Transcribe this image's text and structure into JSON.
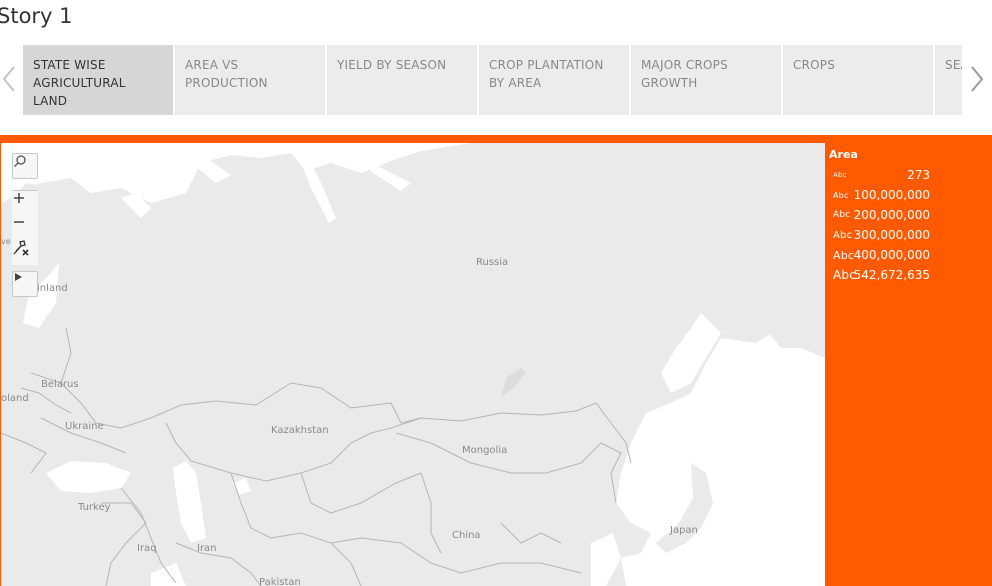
{
  "story": {
    "title": "Story 1"
  },
  "tabs": [
    {
      "label": "STATE WISE AGRICULTURAL LAND",
      "active": true
    },
    {
      "label": "AREA VS PRODUCTION",
      "active": false
    },
    {
      "label": "YIELD BY SEASON",
      "active": false
    },
    {
      "label": "CROP PLANTATION BY AREA",
      "active": false
    },
    {
      "label": "MAJOR CROPS GROWTH",
      "active": false
    },
    {
      "label": "CROPS",
      "active": false
    },
    {
      "label": "SEASON PR",
      "active": false
    }
  ],
  "nav": {
    "prev_icon": "chevron-left-icon",
    "next_icon": "chevron-right-icon"
  },
  "map": {
    "labels": {
      "russia": "Russia",
      "kazakhstan": "Kazakhstan",
      "mongolia": "Mongolia",
      "china": "China",
      "japan": "Japan",
      "belarus": "Belarus",
      "ukraine": "Ukraine",
      "turkey": "Turkey",
      "iraq": "Iraq",
      "iran": "Iran",
      "finland": "inland",
      "poland": "oland",
      "pakistan": "Pakistan",
      "sweden": "ve"
    },
    "toolbar": [
      "search-icon",
      "zoom-in-icon",
      "zoom-out-icon",
      "pin-reset-icon",
      "expand-arrow-icon"
    ]
  },
  "legend": {
    "title": "Area",
    "swatch_text": "Abc",
    "items": [
      {
        "value": "273",
        "swatch_size": 7
      },
      {
        "value": "100,000,000",
        "swatch_size": 8
      },
      {
        "value": "200,000,000",
        "swatch_size": 9
      },
      {
        "value": "300,000,000",
        "swatch_size": 10
      },
      {
        "value": "400,000,000",
        "swatch_size": 11
      },
      {
        "value": "542,672,635",
        "swatch_size": 12
      }
    ]
  },
  "colors": {
    "accent": "#ff5a00",
    "land": "#eaeaea",
    "water": "#ffffff",
    "border": "#b5b5b5",
    "tab_active": "#d6d6d6",
    "tab": "#ececec"
  }
}
